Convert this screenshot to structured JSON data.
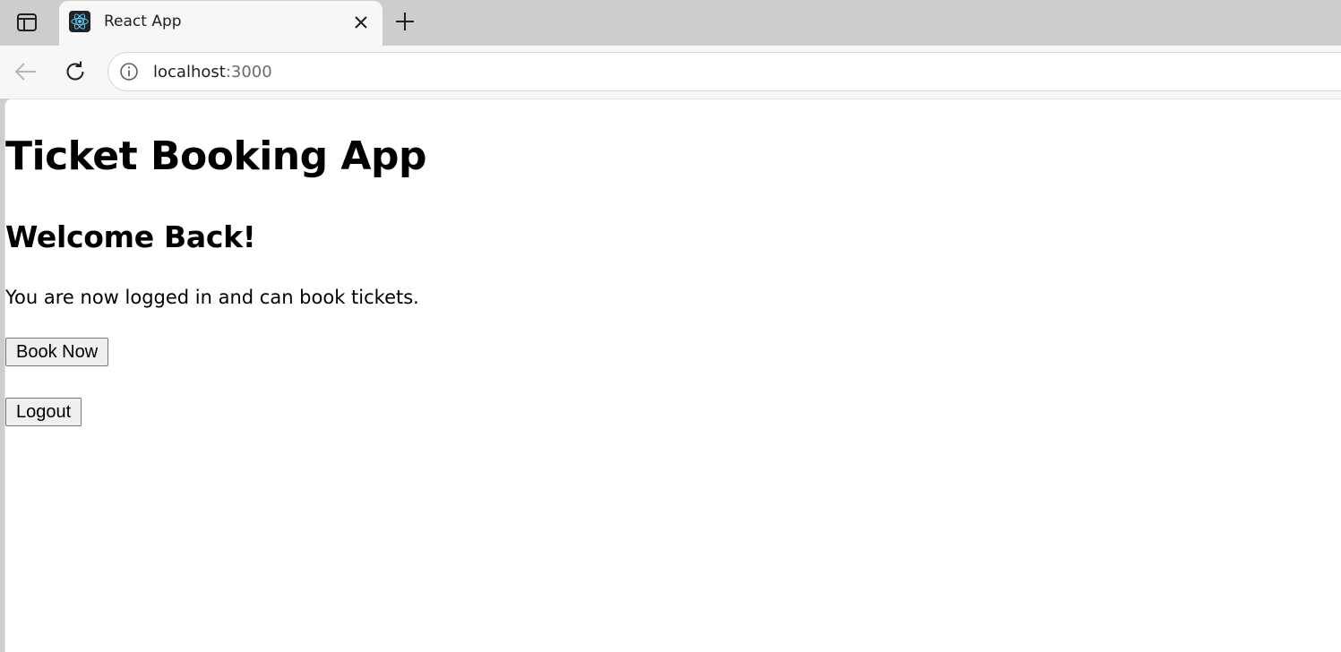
{
  "browser": {
    "tab": {
      "title": "React App"
    },
    "address_bar": {
      "host": "localhost",
      "port": ":3000"
    }
  },
  "page": {
    "title": "Ticket Booking App",
    "welcome_heading": "Welcome Back!",
    "message": "You are now logged in and can book tickets.",
    "book_button_label": "Book Now",
    "logout_button_label": "Logout"
  },
  "colors": {
    "tabstrip_bg": "#cdcdcd",
    "toolbar_bg": "#f7f7f7",
    "react_logo": "#61dafb",
    "favicon_bg": "#20232a"
  },
  "icons": {
    "tab_actions": "tab-actions-icon",
    "favicon": "react-logo-icon",
    "close": "close-icon",
    "new_tab": "plus-icon",
    "back": "back-arrow-icon",
    "reload": "reload-icon",
    "site_info": "info-icon"
  }
}
